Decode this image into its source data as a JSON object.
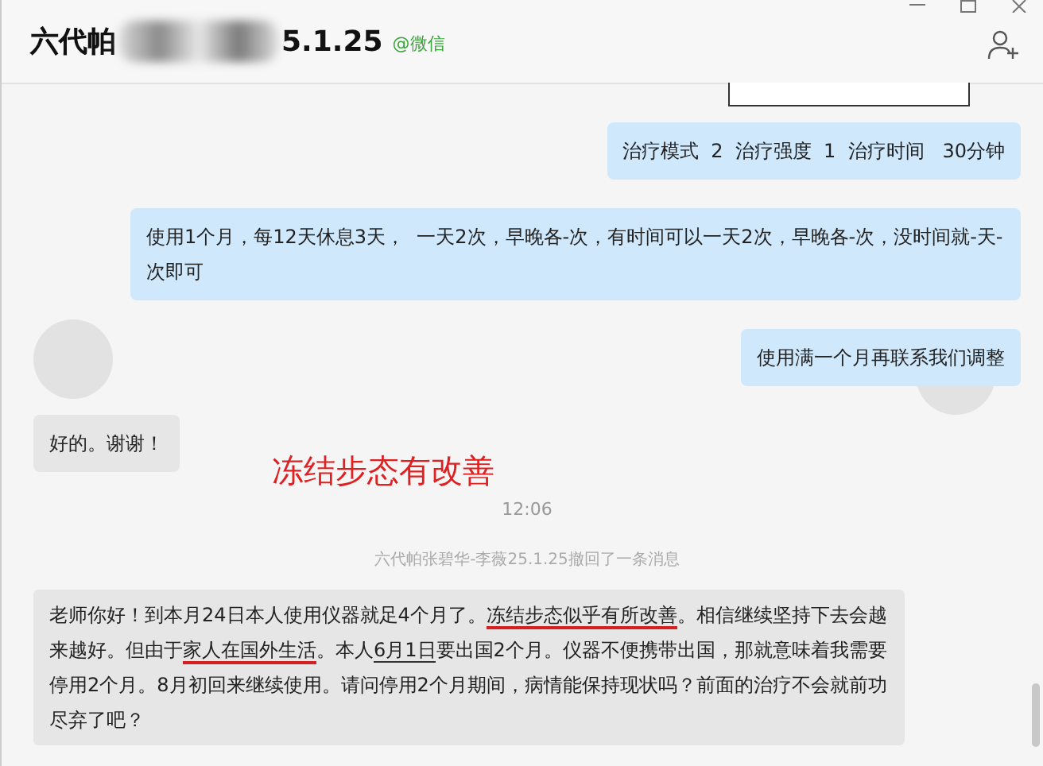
{
  "header": {
    "title_parts": [
      "六代帕",
      "5.1.25"
    ],
    "source": "@微信"
  },
  "messages": [
    {
      "kind": "sent",
      "text": "治疗模式  2  治疗强度  1  治疗时间   30分钟"
    },
    {
      "kind": "sent",
      "text": "使用1个月，每12天休息3天，  一天2次，早晚各-次，有时间可以一天2次，早晚各-次，没时间就-天-次即可"
    },
    {
      "kind": "sent",
      "text": "使用满一个月再联系我们调整"
    },
    {
      "kind": "received",
      "text": "好的。谢谢！"
    }
  ],
  "annotation": "冻结步态有改善",
  "time": "12:06",
  "notice": "六代帕张碧华-李薇25.1.25撤回了一条消息",
  "last_message": {
    "segments": [
      {
        "text": "老师你好！到本月24日本人使用仪器就足4个月了。",
        "kind": "plain"
      },
      {
        "text": "冻结步态似乎有所改善",
        "kind": "marked"
      },
      {
        "text": "。相信继续坚持下去会越来越好。但由于",
        "kind": "plain"
      },
      {
        "text": "家人在国外生活",
        "kind": "marked"
      },
      {
        "text": "。本人",
        "kind": "plain"
      },
      {
        "text": "6月1日",
        "kind": "underlined"
      },
      {
        "text": "要出国2个月。仪器不便携带出国，那就意味着我需要停用2个月。8月初回来继续使用。请问停用2个月期间，病情能保持现状吗？前面的治疗不会就前功尽弃了吧？",
        "kind": "plain"
      }
    ]
  }
}
